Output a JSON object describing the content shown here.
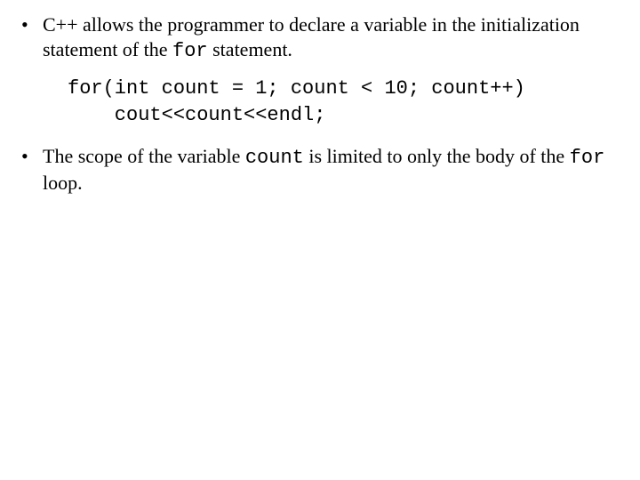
{
  "bullets": {
    "b1_pre": "C++ allows the programmer to declare a variable in the initialization statement of the ",
    "b1_code": "for",
    "b1_post": " statement.",
    "b2_pre": "The scope of the variable ",
    "b2_code1": "count",
    "b2_mid": " is limited to only the body of the ",
    "b2_code2": "for",
    "b2_post": " loop."
  },
  "code": {
    "line1": "for(int count = 1; count < 10; count++)",
    "line2": "    cout<<count<<endl;"
  }
}
